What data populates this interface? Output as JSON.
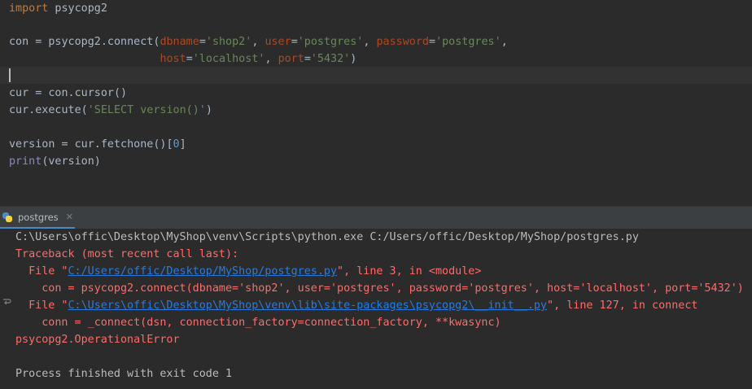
{
  "editor": {
    "lines": [
      [
        {
          "t": "import",
          "c": "kw"
        },
        {
          "t": " psycopg2"
        }
      ],
      [],
      [
        {
          "t": "con = psycopg2.connect("
        },
        {
          "t": "dbname",
          "c": "pn"
        },
        {
          "t": "="
        },
        {
          "t": "'shop2'",
          "c": "st"
        },
        {
          "t": ", "
        },
        {
          "t": "user",
          "c": "pn"
        },
        {
          "t": "="
        },
        {
          "t": "'postgres'",
          "c": "st"
        },
        {
          "t": ", "
        },
        {
          "t": "password",
          "c": "pn"
        },
        {
          "t": "="
        },
        {
          "t": "'postgres'",
          "c": "st"
        },
        {
          "t": ","
        }
      ],
      [
        {
          "t": "                       "
        },
        {
          "t": "host",
          "c": "pn"
        },
        {
          "t": "="
        },
        {
          "t": "'localhost'",
          "c": "st"
        },
        {
          "t": ", "
        },
        {
          "t": "port",
          "c": "pn"
        },
        {
          "t": "="
        },
        {
          "t": "'5432'",
          "c": "st"
        },
        {
          "t": ")"
        }
      ],
      [],
      [
        {
          "t": "cur = con.cursor()"
        }
      ],
      [
        {
          "t": "cur.execute("
        },
        {
          "t": "'SELECT version()'",
          "c": "st"
        },
        {
          "t": ")"
        }
      ],
      [],
      [
        {
          "t": "version = cur.fetchone()["
        },
        {
          "t": "0",
          "c": "nm"
        },
        {
          "t": "]"
        }
      ],
      [
        {
          "t": "print",
          "c": "bi"
        },
        {
          "t": "(version)"
        }
      ]
    ]
  },
  "run_tab": {
    "label": "postgres",
    "icon": "python-file-icon",
    "close_icon": "close-icon"
  },
  "console": {
    "lines": [
      [
        {
          "t": "C:\\Users\\offic\\Desktop\\MyShop\\venv\\Scripts\\python.exe C:/Users/offic/Desktop/MyShop/postgres.py"
        }
      ],
      [
        {
          "t": "Traceback (most recent call last):",
          "c": "err"
        }
      ],
      [
        {
          "t": "  File \"",
          "c": "err"
        },
        {
          "t": "C:/Users/offic/Desktop/MyShop/postgres.py",
          "c": "link"
        },
        {
          "t": "\", line 3, in <module>",
          "c": "err"
        }
      ],
      [
        {
          "t": "    con = psycopg2.connect(dbname='shop2', user='postgres', password='postgres', host='localhost', port='5432')",
          "c": "err"
        }
      ],
      [
        {
          "t": "  File \"",
          "c": "err"
        },
        {
          "t": "C:\\Users\\offic\\Desktop\\MyShop\\venv\\lib\\site-packages\\psycopg2\\__init__.py",
          "c": "link"
        },
        {
          "t": "\", line 127, in connect",
          "c": "err"
        }
      ],
      [
        {
          "t": "    conn = _connect(dsn, connection_factory=connection_factory, **kwasync)",
          "c": "err"
        }
      ],
      [
        {
          "t": "psycopg2.OperationalError",
          "c": "err"
        }
      ],
      [],
      [
        {
          "t": "Process finished with exit code 1"
        }
      ]
    ]
  },
  "colors": {
    "background": "#2b2b2b",
    "keyword": "#cc7832",
    "string": "#6a8759",
    "param": "#aa4926",
    "number": "#6897bb",
    "builtin": "#8888c6",
    "error": "#ff6b68",
    "link": "#287bde"
  }
}
